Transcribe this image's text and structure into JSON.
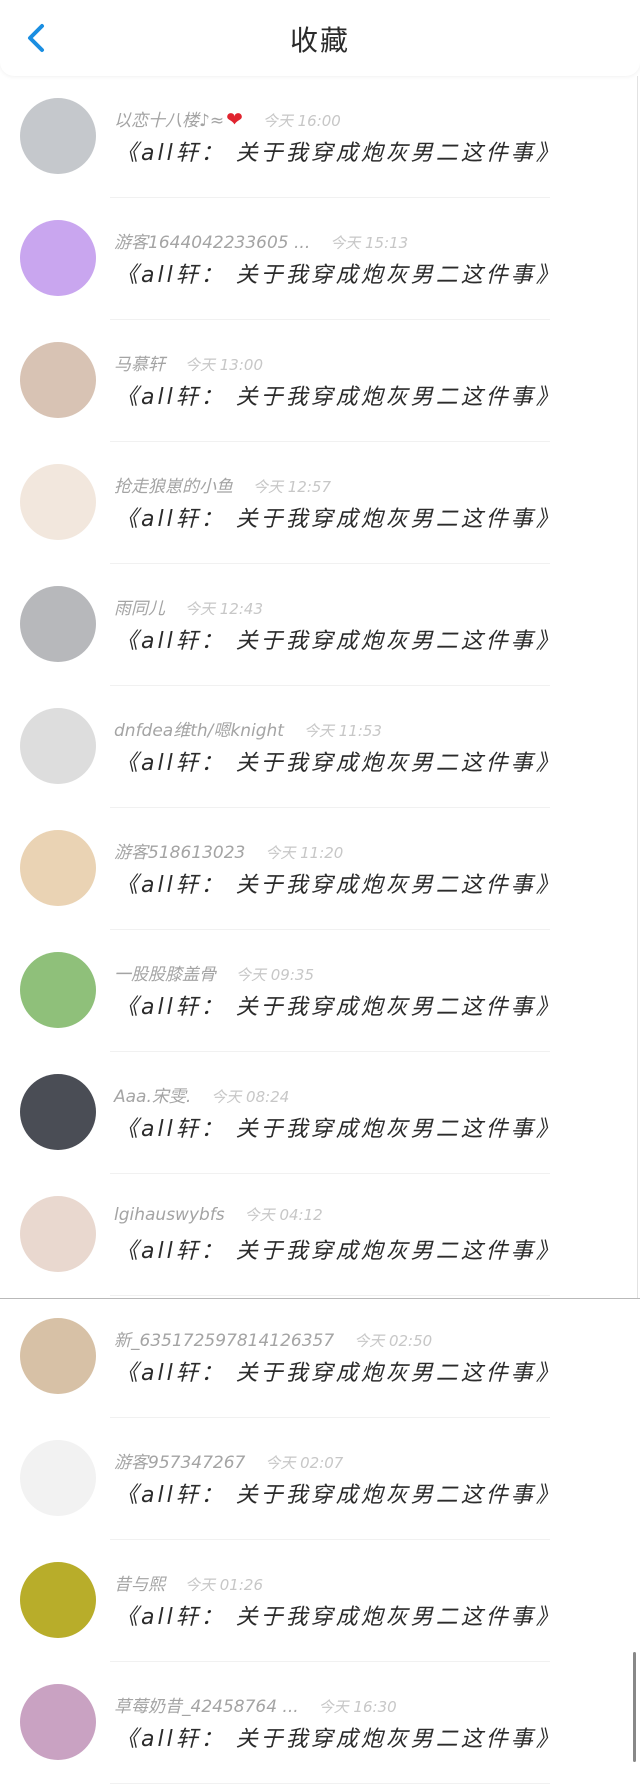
{
  "header": {
    "title": "收藏"
  },
  "items": [
    {
      "user": "以恋十八楼♪≈",
      "time": "今天 16:00",
      "title": "《all轩： 关于我穿成炮灰男二这件事》",
      "heart": true
    },
    {
      "user": "游客1644042233605 ...",
      "time": "今天 15:13",
      "title": "《all轩： 关于我穿成炮灰男二这件事》"
    },
    {
      "user": "马慕轩",
      "time": "今天 13:00",
      "title": "《all轩： 关于我穿成炮灰男二这件事》"
    },
    {
      "user": "抢走狼崽的小鱼",
      "time": "今天 12:57",
      "title": "《all轩： 关于我穿成炮灰男二这件事》"
    },
    {
      "user": "雨同儿",
      "time": "今天 12:43",
      "title": "《all轩： 关于我穿成炮灰男二这件事》"
    },
    {
      "user": "dnfdea维th/嗯knight",
      "time": "今天 11:53",
      "title": "《all轩： 关于我穿成炮灰男二这件事》"
    },
    {
      "user": "游客518613023",
      "time": "今天 11:20",
      "title": "《all轩： 关于我穿成炮灰男二这件事》"
    },
    {
      "user": "一股股膝盖骨",
      "time": "今天 09:35",
      "title": "《all轩： 关于我穿成炮灰男二这件事》"
    },
    {
      "user": "Aaa.宋雯.",
      "time": "今天 08:24",
      "title": "《all轩： 关于我穿成炮灰男二这件事》"
    },
    {
      "user": "lgihauswybfs",
      "time": "今天 04:12",
      "title": "《all轩： 关于我穿成炮灰男二这件事》"
    },
    {
      "user": "新_635172597814126357",
      "time": "今天 02:50",
      "title": "《all轩： 关于我穿成炮灰男二这件事》"
    },
    {
      "user": "游客957347267",
      "time": "今天 02:07",
      "title": "《all轩： 关于我穿成炮灰男二这件事》"
    },
    {
      "user": "昔与熙",
      "time": "今天 01:26",
      "title": "《all轩： 关于我穿成炮灰男二这件事》"
    },
    {
      "user": "草莓奶昔_42458764 ...",
      "time": "今天 16:30",
      "title": "《all轩： 关于我穿成炮灰男二这件事》"
    }
  ],
  "avatars": [
    "#c5c8cc",
    "#c9a6ef",
    "#d8c3b4",
    "#f2e7dd",
    "#b7b8bb",
    "#dddddd",
    "#ead3b4",
    "#8fc07a",
    "#4a4d55",
    "#e9d8cf",
    "#d7c1a6",
    "#f2f2f2",
    "#b8ad2a",
    "#c9a2c2"
  ],
  "icons": {
    "back": "chevron-left-icon",
    "heart": "heart-icon"
  },
  "colors": {
    "accent": "#1a8ee1",
    "heart": "#e0242f"
  }
}
